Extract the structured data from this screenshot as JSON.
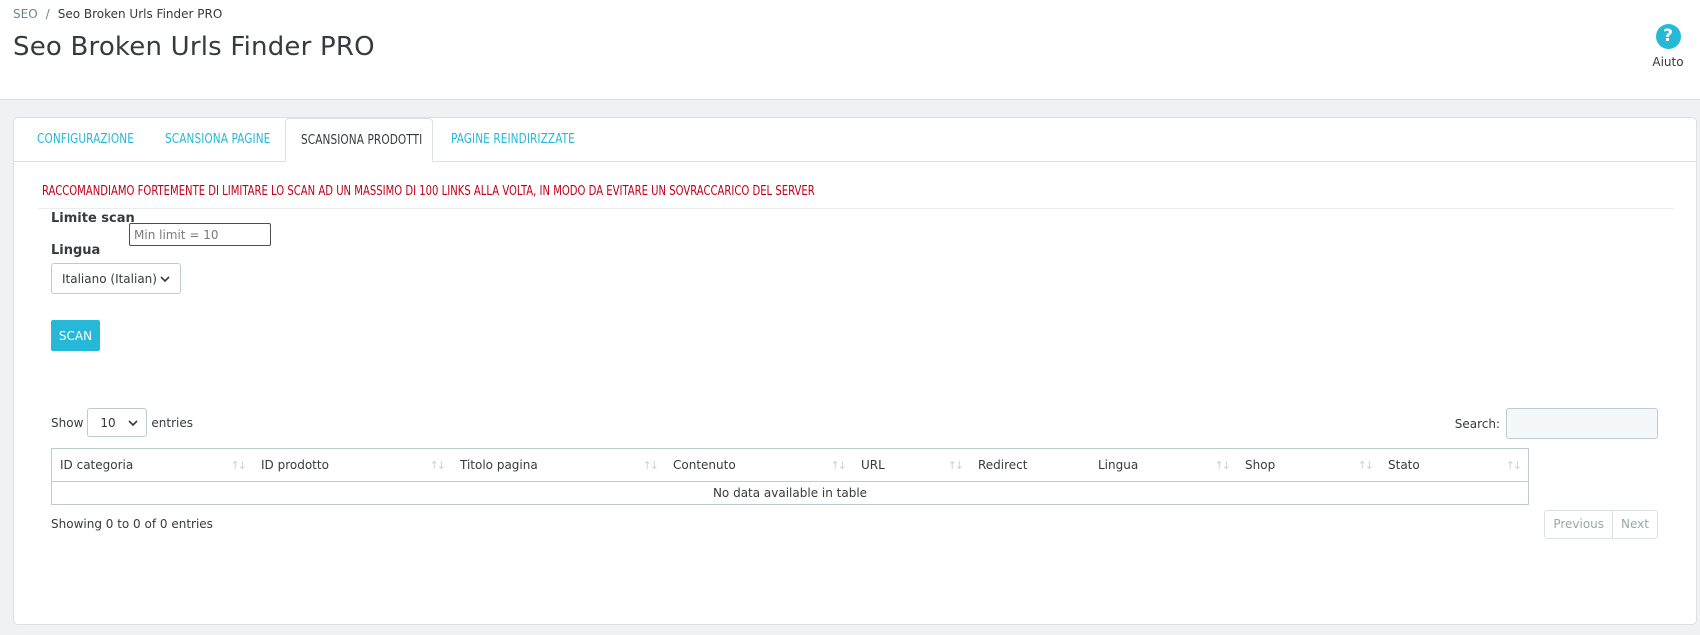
{
  "breadcrumb": {
    "root": "SEO",
    "separator": "/",
    "current": "Seo Broken Urls Finder PRO"
  },
  "page_title": "Seo Broken Urls Finder PRO",
  "help": {
    "icon": "question-circle-icon",
    "label": "Aiuto"
  },
  "tabs": [
    {
      "label": "CONFIGURAZIONE",
      "active": false
    },
    {
      "label": "SCANSIONA PAGINE",
      "active": false
    },
    {
      "label": "SCANSIONA PRODOTTI",
      "active": true
    },
    {
      "label": "PAGINE REINDIRIZZATE",
      "active": false
    }
  ],
  "warning": "RACCOMANDIAMO FORTEMENTE DI LIMITARE LO SCAN AD UN MASSIMO DI 100 LINKS ALLA VOLTA, IN MODO DA EVITARE UN SOVRACCARICO DEL SERVER",
  "form": {
    "limit_label": "Limite scan",
    "limit_placeholder": "Min limit = 10",
    "language_label": "Lingua",
    "language_value": "Italiano (Italian)",
    "scan_button": "SCAN"
  },
  "table_controls": {
    "show_label": "Show",
    "page_length": "10",
    "entries_label": "entries",
    "search_label": "Search:"
  },
  "table": {
    "columns": [
      "ID categoria",
      "ID prodotto",
      "Titolo pagina",
      "Contenuto",
      "URL",
      "Redirect",
      "Lingua",
      "Shop",
      "Stato"
    ],
    "empty_message": "No data available in table"
  },
  "footer": {
    "info": "Showing 0 to 0 of 0 entries",
    "previous": "Previous",
    "next": "Next"
  },
  "colors": {
    "accent": "#25b9d7",
    "warning": "#c3001a",
    "text": "#363a41"
  }
}
